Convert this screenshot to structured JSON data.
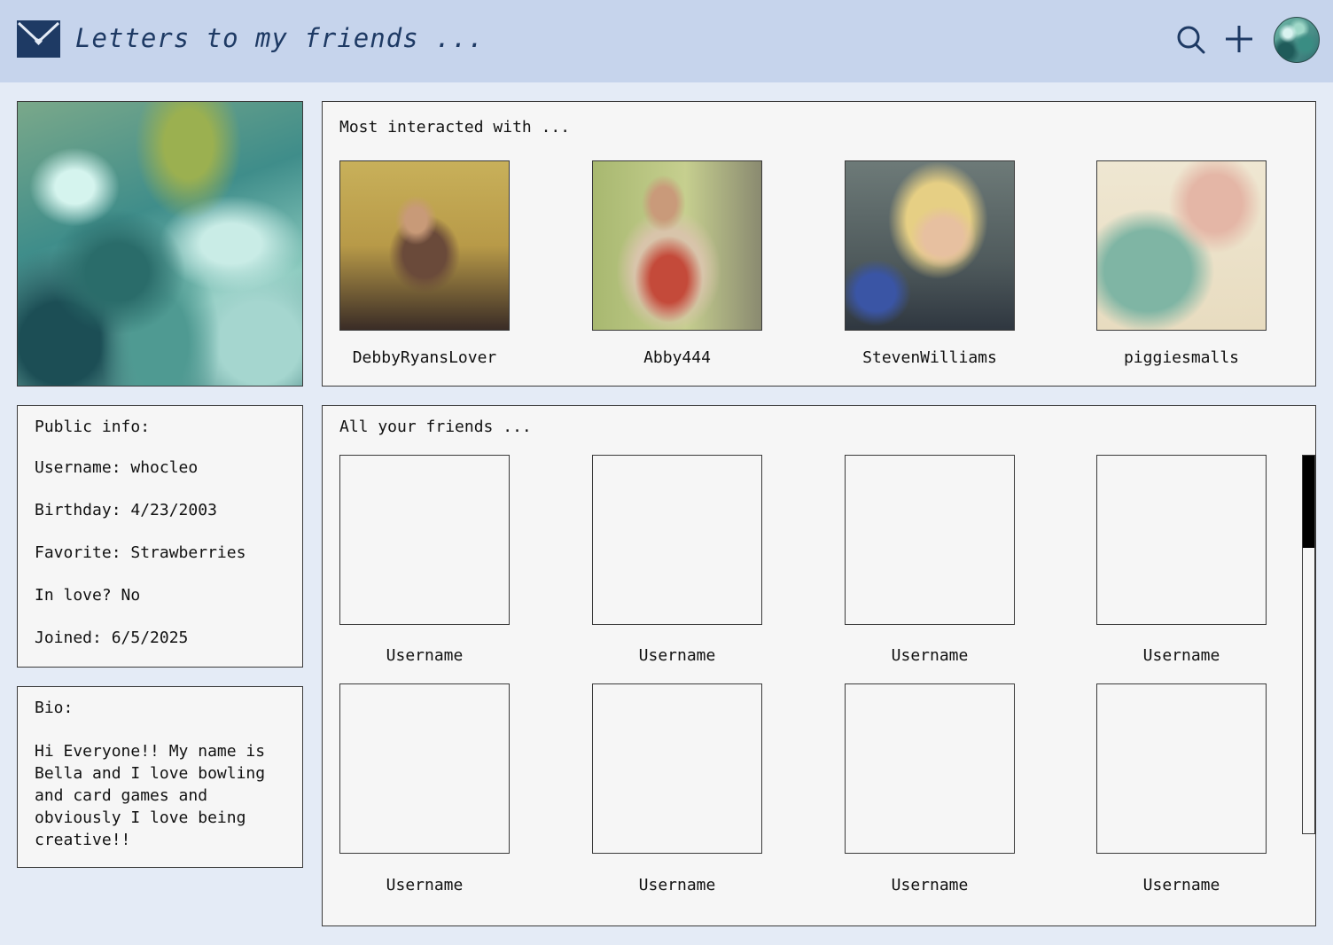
{
  "header": {
    "title": "Letters to my friends ...",
    "logo_icon": "envelope-heart-icon",
    "search_icon": "search-icon",
    "add_icon": "plus-icon",
    "avatar": "user-avatar",
    "colors": {
      "bar": "#c6d4ec",
      "title": "#1e3a64",
      "logo": "#1e3a64"
    }
  },
  "public_info": {
    "heading": "Public info:",
    "username": "Username: whocleo",
    "birthday": "Birthday: 4/23/2003",
    "favorite": "Favorite: Strawberries",
    "in_love": "In love? No",
    "joined": "Joined: 6/5/2025"
  },
  "bio": {
    "heading": "Bio:",
    "text": "Hi Everyone!! My name is Bella and I love bowling and card games and obviously I love being creative!!"
  },
  "most_interacted": {
    "heading": "Most interacted with ...",
    "friends": [
      {
        "username": "DebbyRyansLover"
      },
      {
        "username": "Abby444"
      },
      {
        "username": "StevenWilliams"
      },
      {
        "username": "piggiesmalls"
      }
    ]
  },
  "all_friends": {
    "heading": "All your friends ...",
    "friends": [
      {
        "username": "Username"
      },
      {
        "username": "Username"
      },
      {
        "username": "Username"
      },
      {
        "username": "Username"
      },
      {
        "username": "Username"
      },
      {
        "username": "Username"
      },
      {
        "username": "Username"
      },
      {
        "username": "Username"
      }
    ]
  },
  "colors": {
    "page_bg": "#e4ebf6",
    "panel_bg": "#f6f6f6",
    "border": "#3a3a3a"
  }
}
